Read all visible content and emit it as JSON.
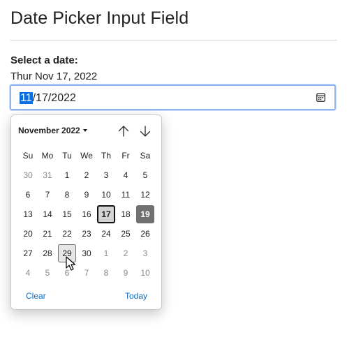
{
  "page": {
    "title": "Date Picker Input Field"
  },
  "field": {
    "label": "Select a date:",
    "selected_text": "Thur Nov 17, 2022",
    "value_month": "11",
    "value_rest": "/17/2022"
  },
  "calendar": {
    "month_label": "November 2022",
    "weekdays": [
      "Su",
      "Mo",
      "Tu",
      "We",
      "Th",
      "Fr",
      "Sa"
    ],
    "weeks": [
      [
        {
          "d": "30",
          "other": true
        },
        {
          "d": "31",
          "other": true
        },
        {
          "d": "1"
        },
        {
          "d": "2"
        },
        {
          "d": "3"
        },
        {
          "d": "4"
        },
        {
          "d": "5"
        }
      ],
      [
        {
          "d": "6"
        },
        {
          "d": "7"
        },
        {
          "d": "8"
        },
        {
          "d": "9"
        },
        {
          "d": "10"
        },
        {
          "d": "11"
        },
        {
          "d": "12"
        }
      ],
      [
        {
          "d": "13"
        },
        {
          "d": "14"
        },
        {
          "d": "15"
        },
        {
          "d": "16"
        },
        {
          "d": "17",
          "state": "today"
        },
        {
          "d": "18"
        },
        {
          "d": "19",
          "state": "selected"
        }
      ],
      [
        {
          "d": "20"
        },
        {
          "d": "21"
        },
        {
          "d": "22"
        },
        {
          "d": "23"
        },
        {
          "d": "24"
        },
        {
          "d": "25"
        },
        {
          "d": "26"
        }
      ],
      [
        {
          "d": "27"
        },
        {
          "d": "28"
        },
        {
          "d": "29",
          "state": "hover"
        },
        {
          "d": "30"
        },
        {
          "d": "1",
          "other": true
        },
        {
          "d": "2",
          "other": true
        },
        {
          "d": "3",
          "other": true
        }
      ],
      [
        {
          "d": "4",
          "other": true
        },
        {
          "d": "5",
          "other": true
        },
        {
          "d": "6",
          "other": true
        },
        {
          "d": "7",
          "other": true
        },
        {
          "d": "8",
          "other": true
        },
        {
          "d": "9",
          "other": true
        },
        {
          "d": "10",
          "other": true
        }
      ]
    ],
    "clear_label": "Clear",
    "today_label": "Today"
  },
  "icons": {
    "calendar": "calendar-icon",
    "month_dropdown": "caret-down-icon",
    "previous": "arrow-up-icon",
    "next": "arrow-down-icon",
    "pointer": "mouse-cursor-icon"
  },
  "colors": {
    "accent": "#0a6ee0",
    "focus_border": "#90b4ef",
    "link": "#0f6cbd",
    "selected_day": "#707070"
  }
}
